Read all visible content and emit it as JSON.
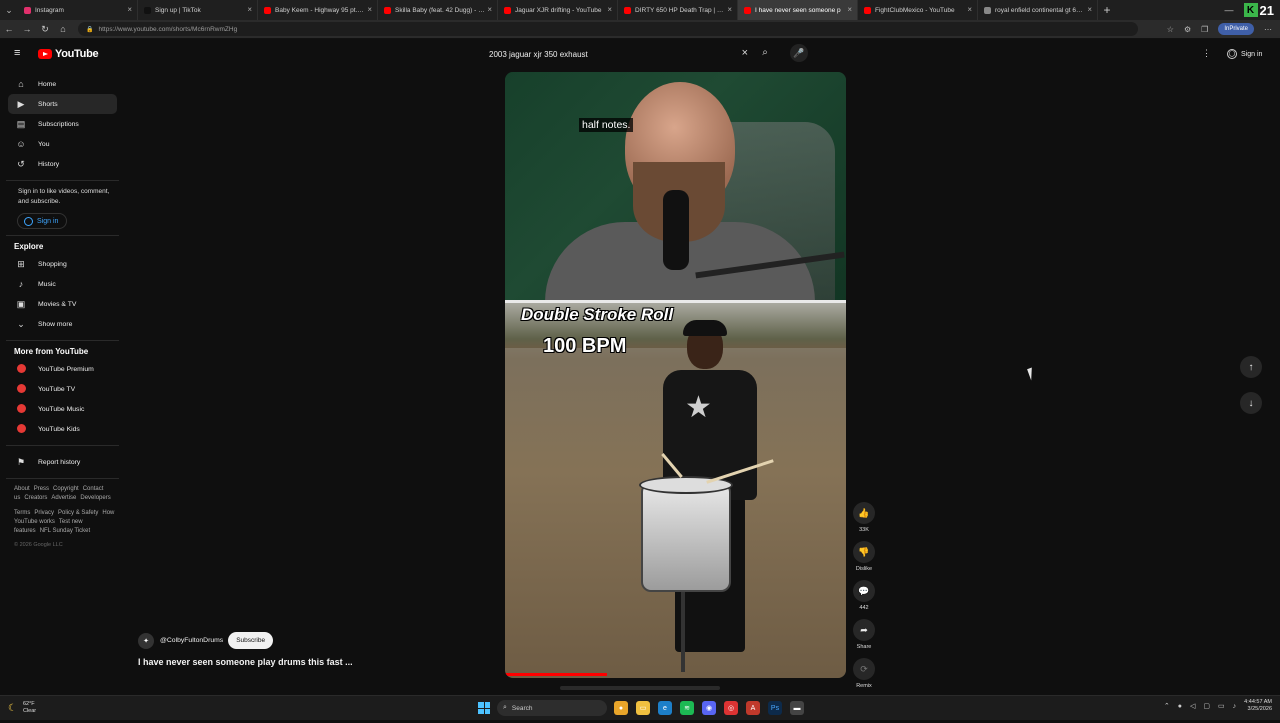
{
  "browser": {
    "tabs": [
      {
        "label": "Instagram",
        "color": "#e1306c",
        "active": false
      },
      {
        "label": "Sign up | TikTok",
        "color": "#111111",
        "active": false
      },
      {
        "label": "Baby Keem - Highway 95 pt. 2 (Of",
        "color": "#ff0000",
        "active": false
      },
      {
        "label": "Skilla Baby (feat. 42 Dugg) - Went",
        "color": "#ff0000",
        "active": false
      },
      {
        "label": "Jaguar XJR drifting - YouTube",
        "color": "#ff0000",
        "active": false
      },
      {
        "label": "DIRTY 650 HP Death Trap | Big Tu",
        "color": "#ff0000",
        "active": false
      },
      {
        "label": "I have never seen someone p",
        "color": "#ff0000",
        "active": true
      },
      {
        "label": "FightClubMexico - YouTube",
        "color": "#ff0000",
        "active": false
      },
      {
        "label": "royal enfield continental gt 650 b",
        "color": "#888888",
        "active": false
      }
    ],
    "url": "https://www.youtube.com/shorts/Mc6rnRwmZHg",
    "inprivate_label": "InPrivate",
    "kbadge": "K",
    "kbadge_num": "21"
  },
  "youtube": {
    "logo_text": "YouTube",
    "search_value": "2003 jaguar xjr 350 exhaust",
    "signin_label": "Sign in",
    "sidebar": {
      "main": [
        {
          "label": "Home",
          "icon": "home-icon",
          "glyph": "⌂",
          "active": false
        },
        {
          "label": "Shorts",
          "icon": "shorts-icon",
          "glyph": "▶",
          "active": true
        },
        {
          "label": "Subscriptions",
          "icon": "subscriptions-icon",
          "glyph": "▤",
          "active": false
        },
        {
          "label": "You",
          "icon": "you-icon",
          "glyph": "☺",
          "active": false
        },
        {
          "label": "History",
          "icon": "history-icon",
          "glyph": "↺",
          "active": false
        }
      ],
      "signin_text": "Sign in to like videos, comment, and subscribe.",
      "signin_btn": "Sign in",
      "explore_heading": "Explore",
      "explore": [
        {
          "label": "Shopping",
          "icon": "shopping-icon",
          "glyph": "⊞"
        },
        {
          "label": "Music",
          "icon": "music-icon",
          "glyph": "♪"
        },
        {
          "label": "Movies & TV",
          "icon": "movies-icon",
          "glyph": "▣"
        },
        {
          "label": "Show more",
          "icon": "chevron-down-icon",
          "glyph": "⌄"
        }
      ],
      "more_heading": "More from YouTube",
      "more": [
        {
          "label": "YouTube Premium"
        },
        {
          "label": "YouTube TV"
        },
        {
          "label": "YouTube Music"
        },
        {
          "label": "YouTube Kids"
        }
      ],
      "report_history": "Report history",
      "footer1": [
        "About",
        "Press",
        "Copyright",
        "Contact us",
        "Creators",
        "Advertise",
        "Developers"
      ],
      "footer2": [
        "Terms",
        "Privacy",
        "Policy & Safety",
        "How YouTube works",
        "Test new features",
        "NFL Sunday Ticket"
      ],
      "copyright": "© 2026 Google LLC"
    },
    "short": {
      "caption": "half notes.",
      "overlay_title": "Double Stroke Roll",
      "overlay_bpm": "100 BPM",
      "progress_fraction": 0.3,
      "channel": "@ColbyFultonDrums",
      "subscribe_label": "Subscribe",
      "title": "I have never seen someone play drums this fast ..."
    },
    "actions": {
      "like_count": "33K",
      "dislike_label": "Dislike",
      "comment_count": "442",
      "share_label": "Share",
      "remix_label": "Remix"
    }
  },
  "taskbar": {
    "temp": "62°F",
    "condition": "Clear",
    "search_placeholder": "Search",
    "time": "4:44:57 AM",
    "date": "3/25/2026"
  }
}
